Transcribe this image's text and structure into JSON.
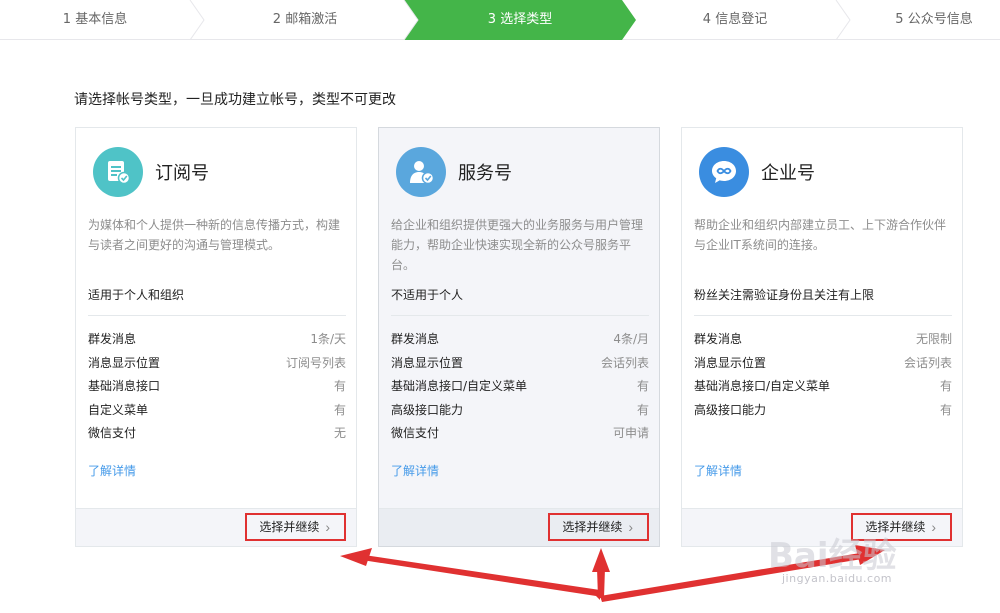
{
  "steps": [
    {
      "label": "1 基本信息"
    },
    {
      "label": "2 邮箱激活"
    },
    {
      "label": "3 选择类型"
    },
    {
      "label": "4 信息登记"
    },
    {
      "label": "5 公众号信息"
    }
  ],
  "instruction": "请选择帐号类型，一旦成功建立帐号，类型不可更改",
  "cards": [
    {
      "title": "订阅号",
      "icon": "subscription-icon",
      "description": "为媒体和个人提供一种新的信息传播方式，构建与读者之间更好的沟通与管理模式。",
      "suitability": "适用于个人和组织",
      "features": [
        {
          "name": "群发消息",
          "value": "1条/天"
        },
        {
          "name": "消息显示位置",
          "value": "订阅号列表"
        },
        {
          "name": "基础消息接口",
          "value": "有"
        },
        {
          "name": "自定义菜单",
          "value": "有"
        },
        {
          "name": "微信支付",
          "value": "无"
        }
      ],
      "link": "了解详情",
      "button": "选择并继续"
    },
    {
      "title": "服务号",
      "icon": "service-icon",
      "description": "给企业和组织提供更强大的业务服务与用户管理能力，帮助企业快速实现全新的公众号服务平台。",
      "suitability": "不适用于个人",
      "features": [
        {
          "name": "群发消息",
          "value": "4条/月"
        },
        {
          "name": "消息显示位置",
          "value": "会话列表"
        },
        {
          "name": "基础消息接口/自定义菜单",
          "value": "有"
        },
        {
          "name": "高级接口能力",
          "value": "有"
        },
        {
          "name": "微信支付",
          "value": "可申请"
        }
      ],
      "link": "了解详情",
      "button": "选择并继续"
    },
    {
      "title": "企业号",
      "icon": "enterprise-icon",
      "description": "帮助企业和组织内部建立员工、上下游合作伙伴与企业IT系统间的连接。",
      "suitability": "粉丝关注需验证身份且关注有上限",
      "features": [
        {
          "name": "群发消息",
          "value": "无限制"
        },
        {
          "name": "消息显示位置",
          "value": "会话列表"
        },
        {
          "name": "基础消息接口/自定义菜单",
          "value": "有"
        },
        {
          "name": "高级接口能力",
          "value": "有"
        }
      ],
      "link": "了解详情",
      "button": "选择并继续"
    }
  ],
  "watermark": {
    "main": "Bai经验",
    "sub": "jingyan.baidu.com"
  },
  "colors": {
    "active_step": "#44b549",
    "link": "#459ae9",
    "highlight": "#e03131"
  }
}
